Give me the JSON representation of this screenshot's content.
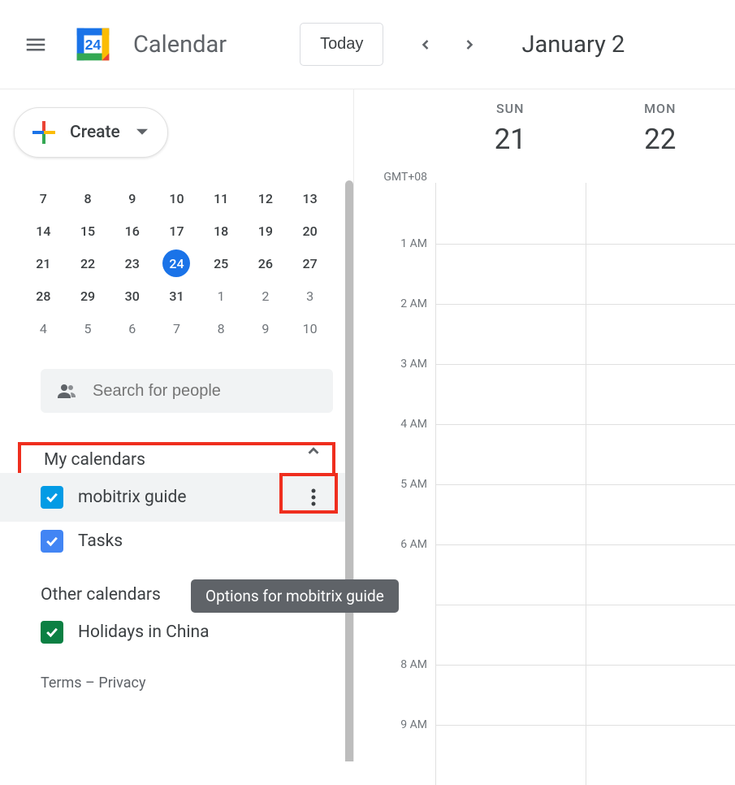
{
  "header": {
    "app_title": "Calendar",
    "logo_number": "24",
    "today_label": "Today",
    "date_range": "January 2"
  },
  "create_button": {
    "label": "Create"
  },
  "mini_calendar": {
    "rows": [
      [
        {
          "d": "7"
        },
        {
          "d": "8"
        },
        {
          "d": "9"
        },
        {
          "d": "10"
        },
        {
          "d": "11"
        },
        {
          "d": "12"
        },
        {
          "d": "13"
        }
      ],
      [
        {
          "d": "14"
        },
        {
          "d": "15"
        },
        {
          "d": "16"
        },
        {
          "d": "17"
        },
        {
          "d": "18"
        },
        {
          "d": "19"
        },
        {
          "d": "20"
        }
      ],
      [
        {
          "d": "21"
        },
        {
          "d": "22"
        },
        {
          "d": "23"
        },
        {
          "d": "24",
          "selected": true
        },
        {
          "d": "25"
        },
        {
          "d": "26"
        },
        {
          "d": "27"
        }
      ],
      [
        {
          "d": "28"
        },
        {
          "d": "29"
        },
        {
          "d": "30"
        },
        {
          "d": "31"
        },
        {
          "d": "1",
          "dim": true
        },
        {
          "d": "2",
          "dim": true
        },
        {
          "d": "3",
          "dim": true
        }
      ],
      [
        {
          "d": "4",
          "dim": true
        },
        {
          "d": "5",
          "dim": true
        },
        {
          "d": "6",
          "dim": true
        },
        {
          "d": "7",
          "dim": true
        },
        {
          "d": "8",
          "dim": true
        },
        {
          "d": "9",
          "dim": true
        },
        {
          "d": "10",
          "dim": true
        }
      ]
    ]
  },
  "search": {
    "placeholder": "Search for people"
  },
  "sections": {
    "my_calendars": {
      "title": "My calendars",
      "items": [
        {
          "label": "mobitrix guide",
          "color": "#039be5",
          "active": true,
          "has_options": true
        },
        {
          "label": "Tasks",
          "color": "#4285f4"
        }
      ]
    },
    "other_calendars": {
      "title": "Other calendars",
      "items": [
        {
          "label": "Holidays in China",
          "color": "#0b8043"
        }
      ]
    }
  },
  "tooltip": "Options for mobitrix guide",
  "footer": {
    "terms": "Terms",
    "sep": " – ",
    "privacy": "Privacy"
  },
  "grid": {
    "timezone": "GMT+08",
    "days": [
      {
        "name": "SUN",
        "num": "21"
      },
      {
        "name": "MON",
        "num": "22"
      }
    ],
    "hours": [
      "",
      "1 AM",
      "2 AM",
      "3 AM",
      "4 AM",
      "5 AM",
      "6 AM",
      "",
      "8 AM",
      "9 AM"
    ]
  }
}
